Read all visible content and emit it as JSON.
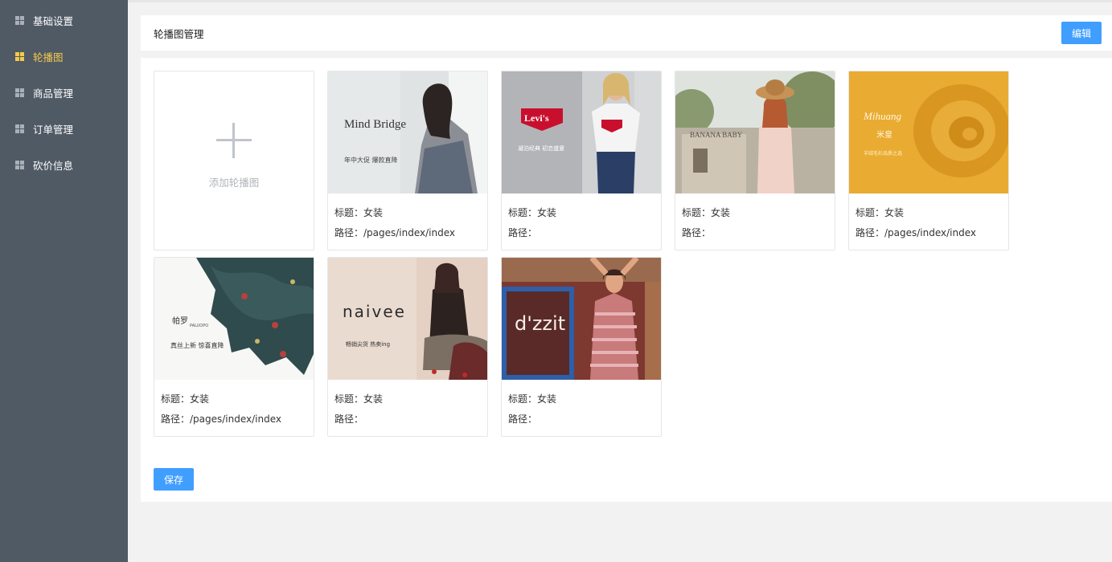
{
  "sidebar": {
    "items": [
      {
        "label": "基础设置",
        "active": false
      },
      {
        "label": "轮播图",
        "active": true
      },
      {
        "label": "商品管理",
        "active": false
      },
      {
        "label": "订单管理",
        "active": false
      },
      {
        "label": "砍价信息",
        "active": false
      }
    ]
  },
  "header": {
    "title": "轮播图管理",
    "edit_label": "编辑"
  },
  "add_card": {
    "label": "添加轮播图"
  },
  "banners": [
    {
      "title": "标题：女装",
      "path": "路径：/pages/index/index",
      "image": {
        "brand": "Mind Bridge",
        "caption": "年中大促 爆款直降"
      }
    },
    {
      "title": "标题：女装",
      "path": "路径：",
      "image": {
        "brand": "Levi's",
        "caption": "凝泊经典 初恋盛夏"
      }
    },
    {
      "title": "标题：女装",
      "path": "路径：",
      "image": {
        "brand": "BANANA BABY",
        "caption": ""
      }
    },
    {
      "title": "标题：女装",
      "path": "路径：/pages/index/index",
      "image": {
        "brand": "Mihuang",
        "sub": "米皇",
        "caption": "羊绒毛衫品质之选"
      }
    },
    {
      "title": "标题：女装",
      "path": "路径：/pages/index/index",
      "image": {
        "brand": "帕罗",
        "sub": "PALUOPO",
        "caption": "真丝上新 惊喜直降"
      }
    },
    {
      "title": "标题：女装",
      "path": "路径：",
      "image": {
        "brand": "naivee",
        "caption": "畅销尖货 热卖ing"
      }
    },
    {
      "title": "标题：女装",
      "path": "路径：",
      "image": {
        "brand": "d'zzit",
        "caption": ""
      }
    }
  ],
  "footer": {
    "save_label": "保存"
  },
  "colors": {
    "sidebar_bg": "#4f5a65",
    "active": "#f6c94a",
    "primary": "#409eff"
  }
}
